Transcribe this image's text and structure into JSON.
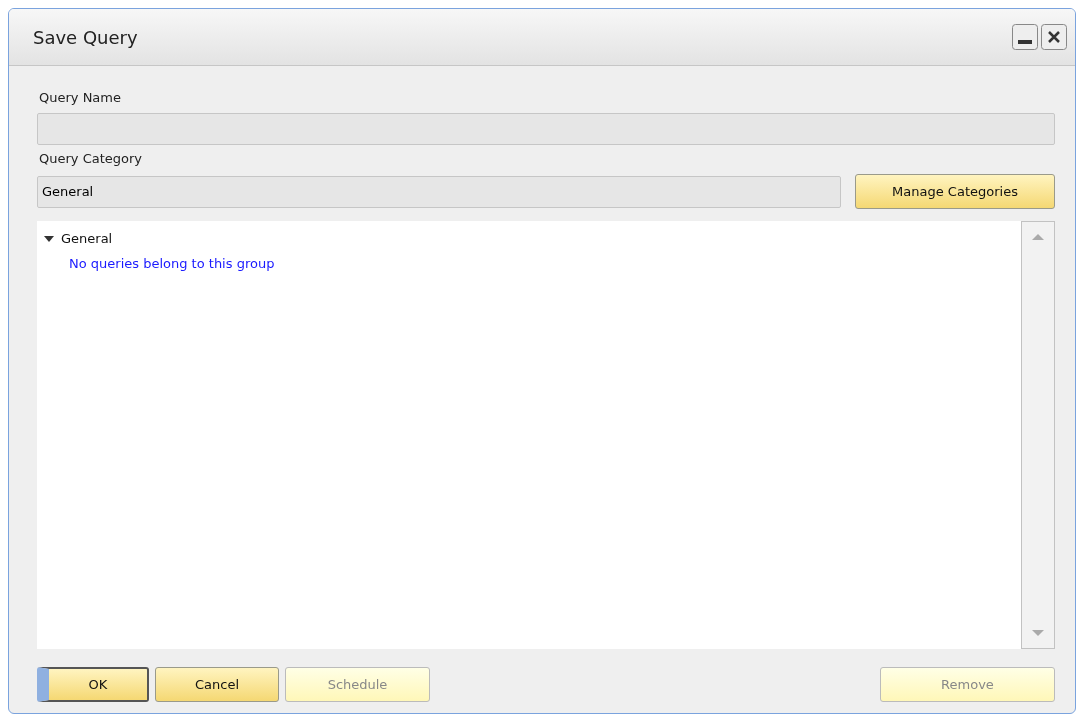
{
  "window": {
    "title": "Save Query"
  },
  "fields": [
    {
      "label": "Query Name"
    },
    {
      "label": "Query Category",
      "value": "General"
    }
  ],
  "manage_button": {
    "label": "Manage Categories"
  },
  "tree": [
    {
      "label": "General",
      "expanded": true,
      "children": [
        {
          "label": "No queries belong to this group",
          "kind": "note"
        }
      ]
    }
  ],
  "buttons": [
    {
      "label": "OK",
      "default": true,
      "disabled": false
    },
    {
      "label": "Cancel",
      "default": false,
      "disabled": false
    },
    {
      "label": "Schedule",
      "default": false,
      "disabled": true
    }
  ],
  "remove_button": {
    "label": "Remove",
    "disabled": true
  }
}
